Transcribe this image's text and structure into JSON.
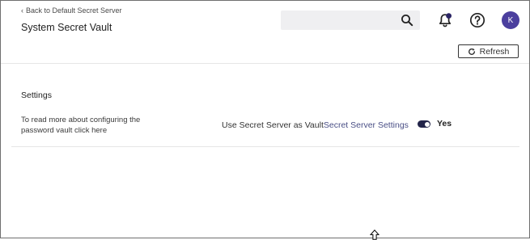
{
  "header": {
    "back_link": "Back to Default Secret Server",
    "title": "System Secret Vault",
    "search": {
      "value": "",
      "placeholder": ""
    },
    "icons": {
      "back": "chevron-left-icon",
      "search": "search-icon",
      "notifications": "bell-icon",
      "help": "help-icon"
    },
    "avatar_initial": "K"
  },
  "toolbar": {
    "refresh_label": "Refresh",
    "refresh_icon": "refresh-icon"
  },
  "settings": {
    "section_title": "Settings",
    "rows": [
      {
        "description": "To read more about configuring the password vault click here",
        "setting_label": "Use Secret Server as Vault",
        "setting_link": "Secret Server Settings",
        "toggle_on": true,
        "toggle_value": "Yes"
      }
    ]
  },
  "colors": {
    "avatar_bg": "#4b3f9e",
    "toggle_bg": "#23254a",
    "link": "#4a4f86",
    "search_bg": "#efeff1"
  }
}
